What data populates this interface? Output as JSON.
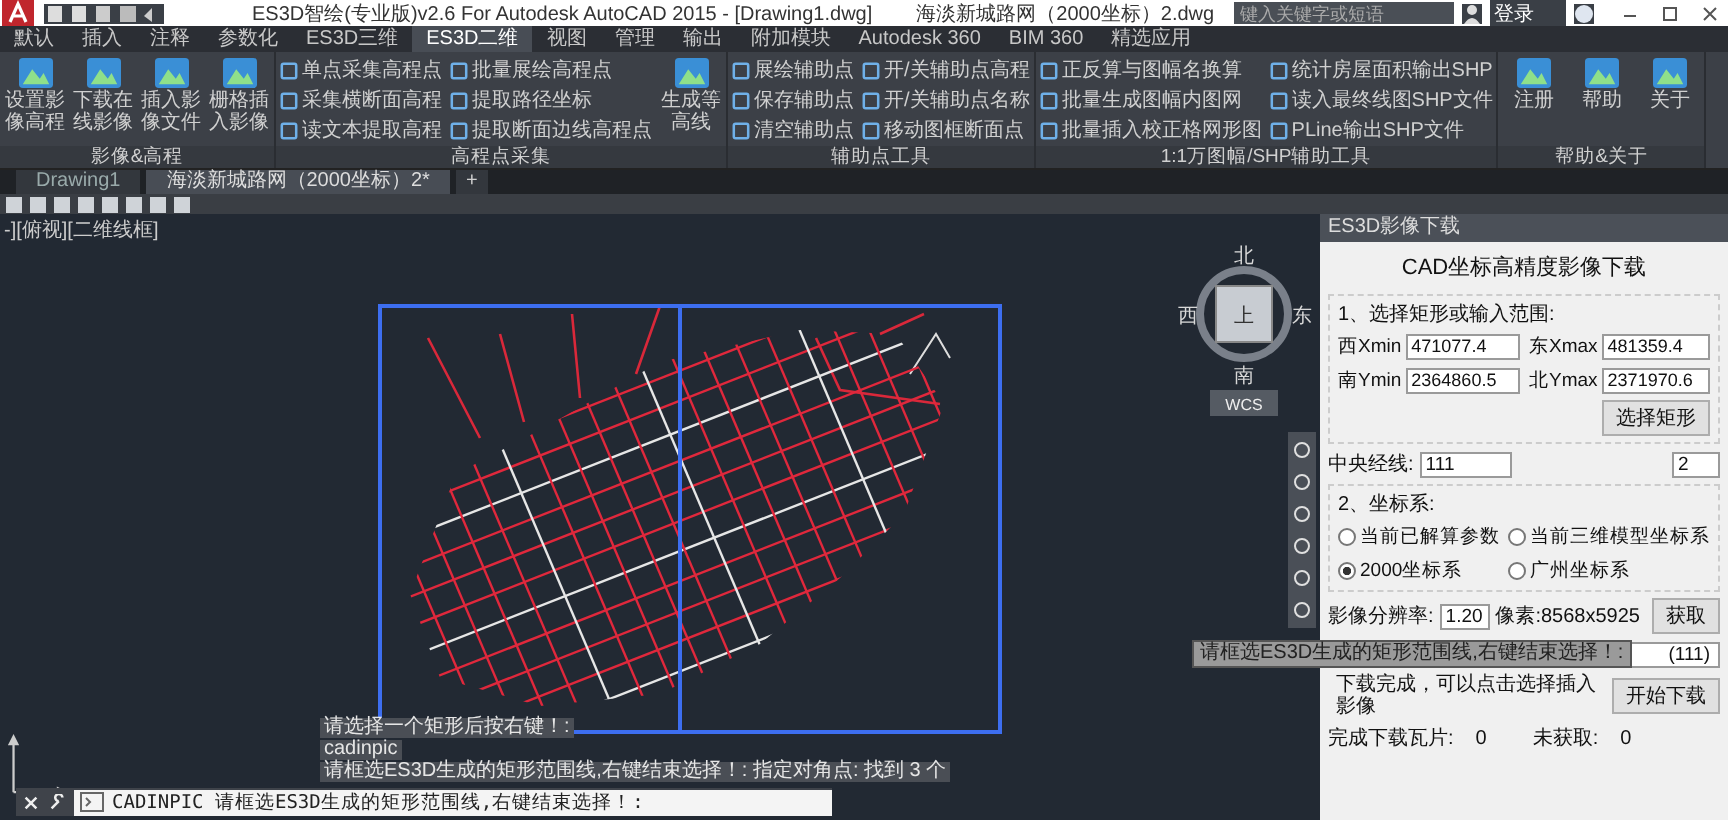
{
  "title_bar": {
    "title": "ES3D智绘(专业版)v2.6 For Autodesk AutoCAD 2015 - [Drawing1.dwg]",
    "second_title": "海淡新城路网（2000坐标）2.dwg",
    "search": {
      "placeholder": "键入关键字或短语"
    },
    "sign_in": "登录"
  },
  "ribbon_tabs": [
    {
      "label": "默认",
      "selected": false
    },
    {
      "label": "插入",
      "selected": false
    },
    {
      "label": "注释",
      "selected": false
    },
    {
      "label": "参数化",
      "selected": false
    },
    {
      "label": "ES3D三维",
      "selected": false
    },
    {
      "label": "ES3D二维",
      "selected": true
    },
    {
      "label": "视图",
      "selected": false
    },
    {
      "label": "管理",
      "selected": false
    },
    {
      "label": "输出",
      "selected": false
    },
    {
      "label": "附加模块",
      "selected": false
    },
    {
      "label": "Autodesk 360",
      "selected": false
    },
    {
      "label": "BIM 360",
      "selected": false
    },
    {
      "label": "精选应用",
      "selected": false
    }
  ],
  "ribbon_panels": [
    {
      "title": "影像&高程",
      "groups": [
        {
          "kind": "large",
          "items": [
            "设置影像高程",
            "下载在线影像",
            "插入影像文件",
            "栅格插入影像"
          ]
        }
      ]
    },
    {
      "title": "高程点采集",
      "groups": [
        {
          "kind": "small",
          "items": [
            "单点采集高程点",
            "采集横断面高程",
            "读文本提取高程"
          ]
        },
        {
          "kind": "small",
          "items": [
            "批量展绘高程点",
            "提取路径坐标",
            "提取断面边线高程点"
          ]
        },
        {
          "kind": "large",
          "items": [
            "生成等高线"
          ]
        }
      ]
    },
    {
      "title": "辅助点工具",
      "groups": [
        {
          "kind": "small",
          "items": [
            "展绘辅助点",
            "保存辅助点",
            "清空辅助点"
          ]
        },
        {
          "kind": "small",
          "items": [
            "开/关辅助点高程",
            "开/关辅助点名称",
            "移动图框断面点"
          ]
        }
      ]
    },
    {
      "title": "1:1万图幅/SHP辅助工具",
      "groups": [
        {
          "kind": "small",
          "items": [
            "正反算与图幅名换算",
            "批量生成图幅内图网",
            "批量插入校正格网形图"
          ]
        },
        {
          "kind": "small",
          "items": [
            "统计房屋面积输出SHP",
            "读入最终线图SHP文件",
            "PLine输出SHP文件"
          ]
        }
      ]
    },
    {
      "title": "帮助&关于",
      "groups": [
        {
          "kind": "large",
          "items": [
            "注册",
            "帮助",
            "关于"
          ]
        }
      ]
    }
  ],
  "doc_tabs": [
    {
      "label": "Drawing1",
      "selected": false
    },
    {
      "label": "海淡新城路网（2000坐标）2*",
      "selected": true
    }
  ],
  "new_tab_button": "+",
  "viewport_label": "-][俯视][二维线框]",
  "viewcube": {
    "north": "北",
    "south": "南",
    "west": "西",
    "east": "东",
    "top": "上",
    "wcs": "WCS"
  },
  "command_history": [
    "请选择一个矩形后按右键！:",
    "cadinpic",
    "请框选ES3D生成的矩形范围线,右键结束选择！: 指定对角点: 找到 3 个"
  ],
  "command_line": {
    "value": "CADINPIC 请框选ES3D生成的矩形范围线,右键结束选择！:"
  },
  "tooltip": "请框选ES3D生成的矩形范围线,右键结束选择！:",
  "image_download_panel": {
    "title": "ES3D影像下载",
    "heading": "CAD坐标高精度影像下载",
    "range_group": {
      "label": "1、选择矩形或输入范围:",
      "fields": [
        {
          "label": "西Xmin",
          "value": "471077.4"
        },
        {
          "label": "东Xmax",
          "value": "481359.4"
        },
        {
          "label": "南Ymin",
          "value": "2364860.5"
        },
        {
          "label": "北Ymax",
          "value": "2371970.6"
        }
      ],
      "select_button": "选择矩形"
    },
    "central_meridian": {
      "label": "中央经线:",
      "value": "111",
      "zone": "2"
    },
    "coordinate_group": {
      "label": "2、坐标系:",
      "options": [
        {
          "label": "当前已解算参数",
          "selected": false
        },
        {
          "label": "当前三维模型坐标系",
          "selected": false
        },
        {
          "label": "2000坐标系",
          "selected": true
        },
        {
          "label": "广州坐标系",
          "selected": false
        }
      ]
    },
    "resolution": {
      "label": "影像分辨率:",
      "value": "1.20",
      "pixels": "像素:8568x5925",
      "button": "获取"
    },
    "output_path": {
      "value": "(111)"
    },
    "status": "下载完成，可以点击选择插入影像",
    "start_button": "开始下载",
    "stats": [
      {
        "label": "完成下载瓦片:",
        "value": "0"
      },
      {
        "label": "未获取:",
        "value": "0"
      }
    ]
  }
}
